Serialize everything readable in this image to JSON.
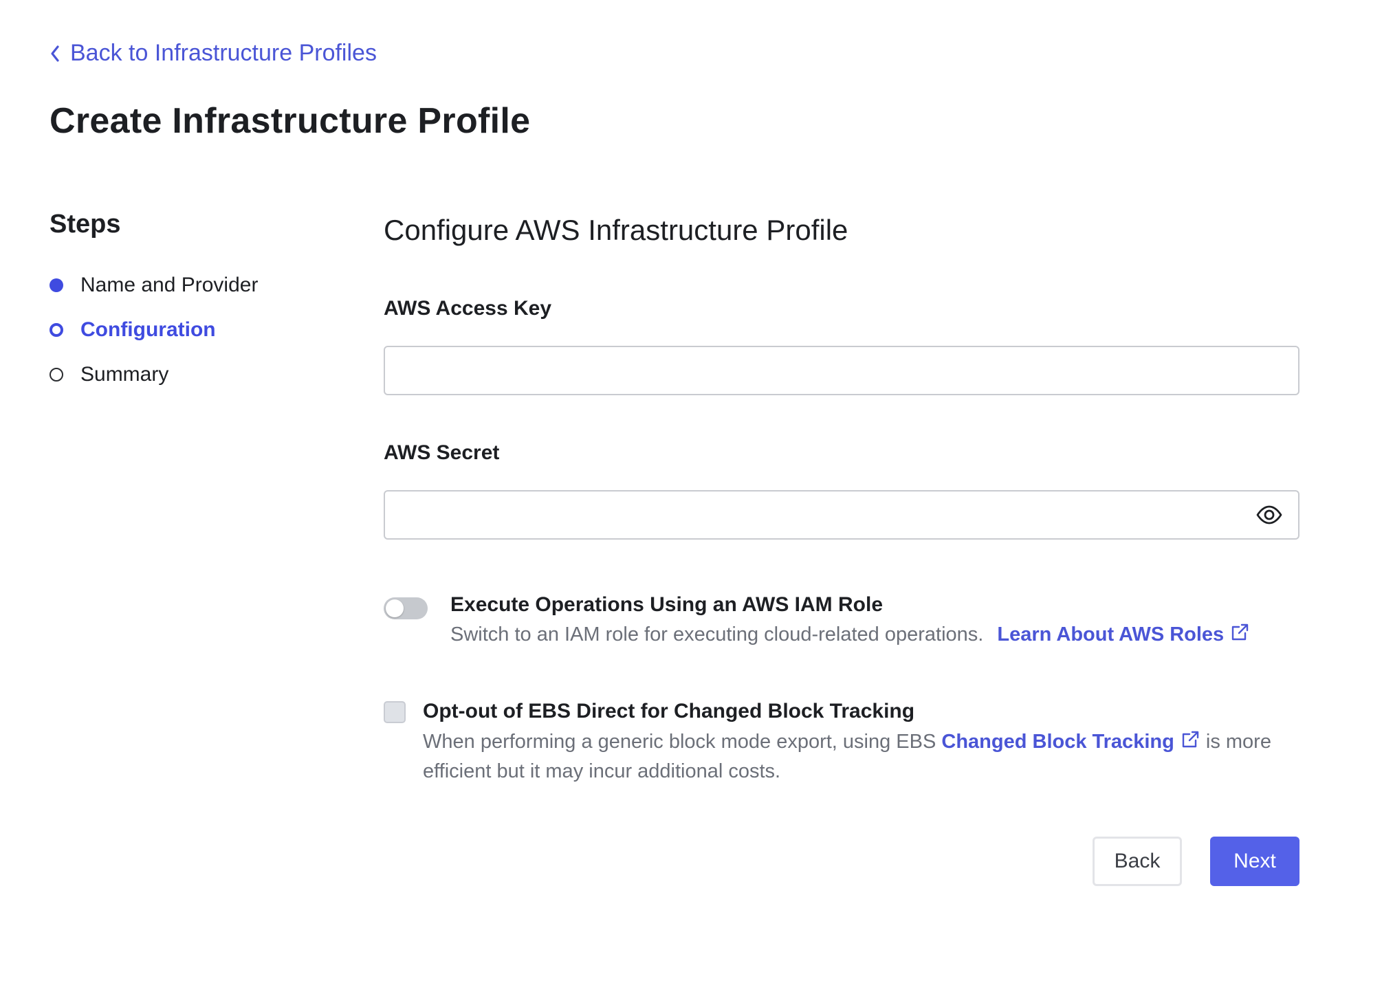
{
  "back_link": {
    "label": "Back to Infrastructure Profiles",
    "icon": "chevron-left-icon"
  },
  "page_title": "Create Infrastructure Profile",
  "steps": {
    "heading": "Steps",
    "items": [
      {
        "label": "Name and Provider",
        "state": "done"
      },
      {
        "label": "Configuration",
        "state": "current"
      },
      {
        "label": "Summary",
        "state": "todo"
      }
    ]
  },
  "form": {
    "section_title": "Configure AWS Infrastructure Profile",
    "access_key": {
      "label": "AWS Access Key",
      "value": "",
      "placeholder": ""
    },
    "secret": {
      "label": "AWS Secret",
      "value": "",
      "placeholder": "",
      "icon": "eye-icon"
    },
    "iam_role": {
      "title": "Execute Operations Using an AWS IAM Role",
      "description": "Switch to an IAM role for executing cloud-related operations.",
      "link_label": "Learn About AWS Roles",
      "enabled": false
    },
    "ebs_opt_out": {
      "title": "Opt-out of EBS Direct for Changed Block Tracking",
      "desc_before": "When performing a generic block mode export, using EBS",
      "link_label": "Changed Block Tracking",
      "desc_after": "is more efficient but it may incur additional costs.",
      "checked": false
    }
  },
  "buttons": {
    "back": "Back",
    "next": "Next"
  },
  "colors": {
    "accent": "#3f4be0",
    "link": "#4a55d6",
    "primary_button": "#5461e8",
    "text": "#1d1f23",
    "muted_text": "#6b6f78"
  }
}
